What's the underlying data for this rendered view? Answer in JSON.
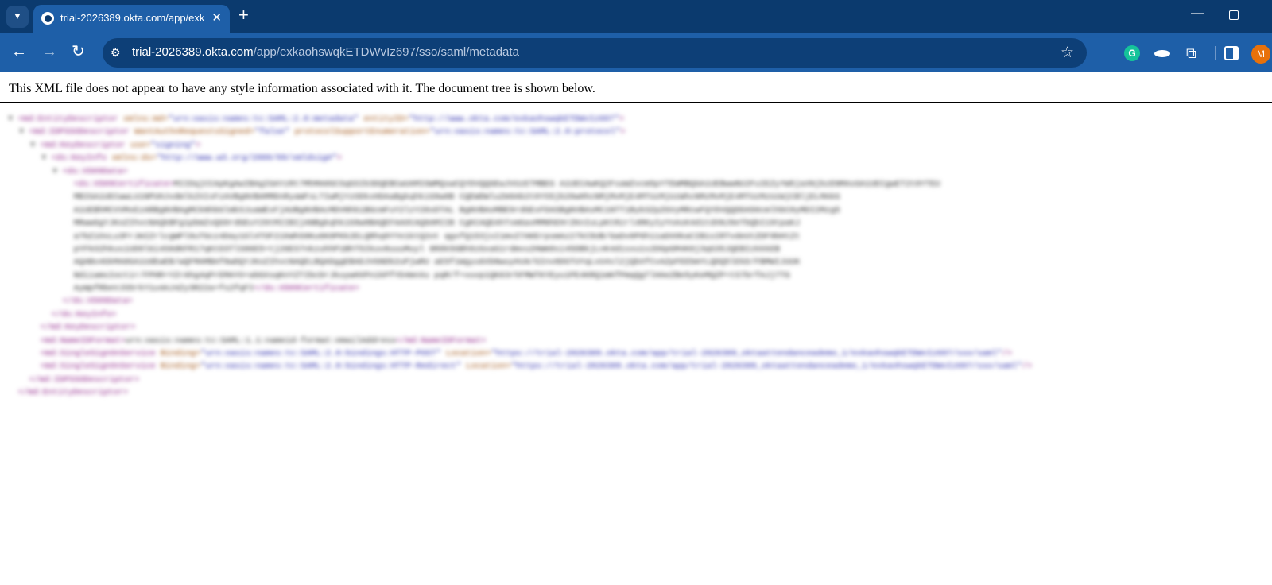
{
  "browser": {
    "tab_title": "trial-2026389.okta.com/app/exk",
    "new_tab_label": "+",
    "url_host": "trial-2026389.okta.com",
    "url_path": "/app/exkaohswqkETDWvIz697/sso/saml/metadata",
    "avatar_initial": "M",
    "colors": {
      "tabstrip": "#0b3a6e",
      "toolbar": "#1e5fa8",
      "omnibox": "#0d3f77"
    }
  },
  "page": {
    "notice": "This XML file does not appear to have any style information associated with it. The document tree is shown below."
  },
  "xml_lines": [
    {
      "indent": 0,
      "tri": "▼",
      "parts": [
        [
          "t",
          "<md:EntityDescriptor "
        ],
        [
          "a",
          "xmlns:md="
        ],
        [
          "v",
          "\"urn:oasis:names:tc:SAML:2.0:metadata\" "
        ],
        [
          "a",
          "entityID="
        ],
        [
          "v",
          "\"http://www.okta.com/exkaohswqkETDWvIz697\""
        ],
        [
          "t",
          ">"
        ]
      ]
    },
    {
      "indent": 1,
      "tri": "▼",
      "parts": [
        [
          "t",
          "<md:IDPSSODescriptor "
        ],
        [
          "a",
          "WantAuthnRequestsSigned="
        ],
        [
          "v",
          "\"false\" "
        ],
        [
          "a",
          "protocolSupportEnumeration="
        ],
        [
          "v",
          "\"urn:oasis:names:tc:SAML:2.0:protocol\""
        ],
        [
          "t",
          ">"
        ]
      ]
    },
    {
      "indent": 2,
      "tri": "▼",
      "parts": [
        [
          "t",
          "<md:KeyDescriptor "
        ],
        [
          "a",
          "use="
        ],
        [
          "v",
          "\"signing\""
        ],
        [
          "t",
          ">"
        ]
      ]
    },
    {
      "indent": 3,
      "tri": "▼",
      "parts": [
        [
          "t",
          "<ds:KeyInfo "
        ],
        [
          "a",
          "xmlns:ds="
        ],
        [
          "v",
          "\"http://www.w3.org/2000/09/xmldsig#\""
        ],
        [
          "t",
          ">"
        ]
      ]
    },
    {
      "indent": 4,
      "tri": "▼",
      "parts": [
        [
          "t",
          "<ds:X509Data>"
        ]
      ]
    },
    {
      "indent": 5,
      "tri": "",
      "parts": [
        [
          "t",
          "<ds:X509Certificate>"
        ],
        [
          "c",
          "MIIDqjCCApKgAwIBAgIGAYzRt7MhMA0GCSqGSIb3DQEBCwUAMIGWMQswCQYDVQQGEwJVUzETMBEG A1UECAwKQ2FsaWZvcm5pYTEWMBQGA1UEBwwNU2FuIEZyYW5jaXNjbzENMAsGA1UECgwET2t0YTEU"
        ]
      ]
    },
    {
      "indent": 5,
      "tri": "",
      "parts": [
        [
          "c",
          "MBIGA1UECwwLU1NPUHJvdmlkZXIxFzAVBgNVBAMMDnRyaWFsLTIwMjYzODkxHDAaBgkqhkiG9w0B CQEWDWluZm9Ab2t0YS5jb20wHhcNMjMxMjE4MTUzMjUzWhcNMzMxMjE4MTUzMzUzWjCBljELMAkG"
        ]
      ]
    },
    {
      "indent": 5,
      "tri": "",
      "parts": [
        [
          "c",
          "A1UEBhMCVVMxEzARBgNVBAgMCkNhbGlmb3JuaWExFjAUBgNVBAcMDVNhbiBGcmFuY2lzY28xDTAL BgNVBAoMBE9rdGExFDASBgNVBAsMC1NTT1Byb3ZpZGVyMRcwFQYDVQQDDA50cmlhbC0yMDI2Mzg5"
        ]
      ]
    },
    {
      "indent": 5,
      "tri": "",
      "parts": [
        [
          "c",
          "MRwwGgYJKoZIhvcNAQkBFg1pbmZvQG9rdGEuY29tMIIBIjANBgkqhkiG9w0BAQEFAAOCAQ8AMIIB CgKCAQEAhTxmGaxMMNhEHrZKnIuLpKtRzrl4RKyIyYnAsK4d1tdXNJ9eTbQbI19tpaKJ"
        ]
      ]
    },
    {
      "indent": 5,
      "tri": "",
      "parts": [
        [
          "c",
          "a7bZiOsLu3FrJmIZrlcgWPl9uTGcz4Day1Gl4TOF21kWhS0Ku6K0PKk2ELQRhq9YYe1ktQ2ot qgxfQ153jsI1mvZ7AKErpsmAz27kC5UB/GaDv0P6h11aDX0kaCIB1sIRTvdeUtZDF9bHtZt"
        ]
      ]
    },
    {
      "indent": 5,
      "tri": "",
      "parts": [
        [
          "c",
          "pYFkO2hkusiUD9l6i4S0dKFR17qKtD3TlS86E5+tj26ES7nkzuhhP1BhT5Ikuv8uuuMuyl 8R8k5GBh9zGxaG1rdmvu2HWm9si45DBkjLnK4d1sxu1s2DGpGM4K0j3qG35JQEBIzkkkEB"
        ]
      ]
    },
    {
      "indent": 5,
      "tri": "",
      "parts": [
        [
          "c",
          "AQABo4GkMA8GA1UdEwEB/wQFMAMBAf8wDQYJKoZIhvcNAQELBQADggEBADJVGNDb2uPjwRU aE5f1Wgyu6XbNwuyHsN/GInv8DGTUYqLvU4sl2jQbXfCvAZpFEEbmYLQDQ5lEkD/FBMWIJUUK"
        ]
      ]
    },
    {
      "indent": 5,
      "tri": "",
      "parts": [
        [
          "c",
          "NdiiamsIoctir/FPHR+YZrAhg4qPrEMAYO+abGXsqKnYZTIbcDrJkuywHXPn1kPfYD4mnXu pqM/f+vuvp1QK63rhFMWTKYEyu1PE4KRQ1mKfPmqQgTlHAeZBe5yKeMQZP+tS7brfAJj7TG"
        ]
      ]
    },
    {
      "indent": 5,
      "tri": "",
      "parts": [
        [
          "c",
          "AyWpfRbeVJS5rkY1u4AJ4Zy3R22a+fs2fqFI"
        ],
        [
          "t",
          "</ds:X509Certificate>"
        ]
      ]
    },
    {
      "indent": 4,
      "tri": "",
      "parts": [
        [
          "t",
          "</ds:X509Data>"
        ]
      ]
    },
    {
      "indent": 3,
      "tri": "",
      "parts": [
        [
          "t",
          "</ds:KeyInfo>"
        ]
      ]
    },
    {
      "indent": 2,
      "tri": "",
      "parts": [
        [
          "t",
          "</md:KeyDescriptor>"
        ]
      ]
    },
    {
      "indent": 2,
      "tri": "",
      "parts": [
        [
          "t",
          "<md:NameIDFormat>"
        ],
        [
          "c",
          "urn:oasis:names:tc:SAML:1.1:nameid-format:emailAddress"
        ],
        [
          "t",
          "</md:NameIDFormat>"
        ]
      ]
    },
    {
      "indent": 2,
      "tri": "",
      "parts": [
        [
          "t",
          "<md:SingleSignOnService "
        ],
        [
          "a",
          "Binding="
        ],
        [
          "v",
          "\"urn:oasis:names:tc:SAML:2.0:bindings:HTTP-POST\" "
        ],
        [
          "a",
          "Location="
        ],
        [
          "v",
          "\"https://trial-2026389.okta.com/app/trial-2026389_oktaattendanceademo_1/exkaohswqkETDWvIz697/sso/saml\""
        ],
        [
          "t",
          "/>"
        ]
      ]
    },
    {
      "indent": 2,
      "tri": "",
      "parts": [
        [
          "t",
          "<md:SingleSignOnService "
        ],
        [
          "a",
          "Binding="
        ],
        [
          "v",
          "\"urn:oasis:names:tc:SAML:2.0:bindings:HTTP-Redirect\" "
        ],
        [
          "a",
          "Location="
        ],
        [
          "v",
          "\"https://trial-2026389.okta.com/app/trial-2026389_oktaattendanceademo_1/exkaohswqkETDWvIz697/sso/saml\""
        ],
        [
          "t",
          "/>"
        ]
      ]
    },
    {
      "indent": 1,
      "tri": "",
      "parts": [
        [
          "t",
          "</md:IDPSSODescriptor>"
        ]
      ]
    },
    {
      "indent": 0,
      "tri": "",
      "parts": [
        [
          "t",
          "</md:EntityDescriptor>"
        ]
      ]
    }
  ]
}
